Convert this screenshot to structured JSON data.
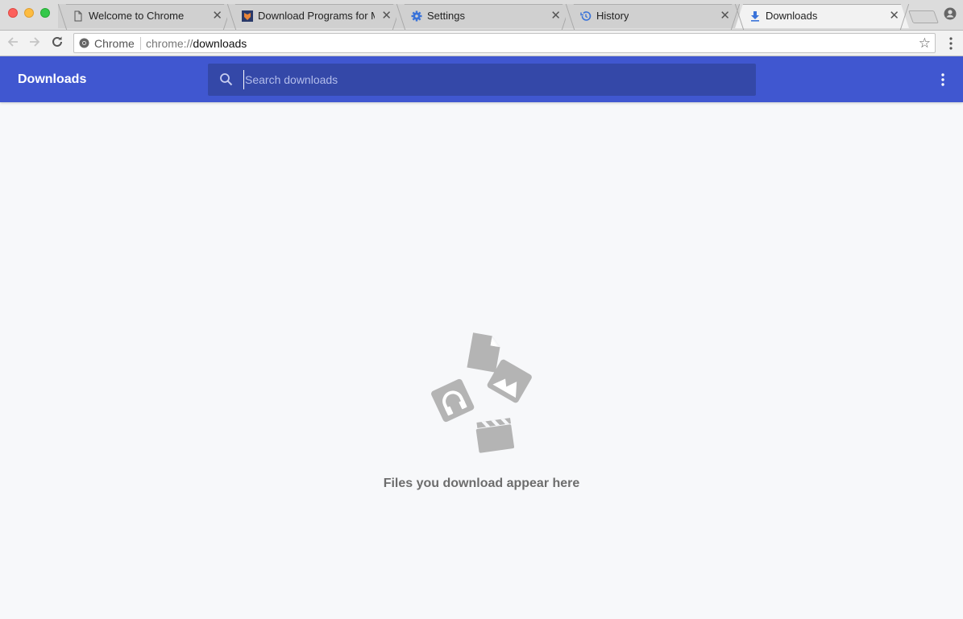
{
  "window": {
    "tabs": [
      {
        "title": "Welcome to Chrome",
        "icon": "page-icon",
        "active": false
      },
      {
        "title": "Download Programs for Mac",
        "icon": "site-favicon",
        "active": false
      },
      {
        "title": "Settings",
        "icon": "gear-icon",
        "active": false
      },
      {
        "title": "History",
        "icon": "history-icon",
        "active": false
      },
      {
        "title": "Downloads",
        "icon": "download-icon",
        "active": true
      }
    ],
    "close_glyph": "✕"
  },
  "omnibox": {
    "chip_label": "Chrome",
    "url_prefix": "chrome://",
    "url_host": "downloads",
    "star_glyph": "☆"
  },
  "header": {
    "title": "Downloads",
    "search_placeholder": "Search downloads",
    "search_value": ""
  },
  "empty_state": {
    "message": "Files you download appear here"
  },
  "colors": {
    "header_bg": "#4057d0",
    "search_bg": "#3448a8",
    "page_bg": "#f7f8fa",
    "illustration": "#b4b4b4"
  }
}
